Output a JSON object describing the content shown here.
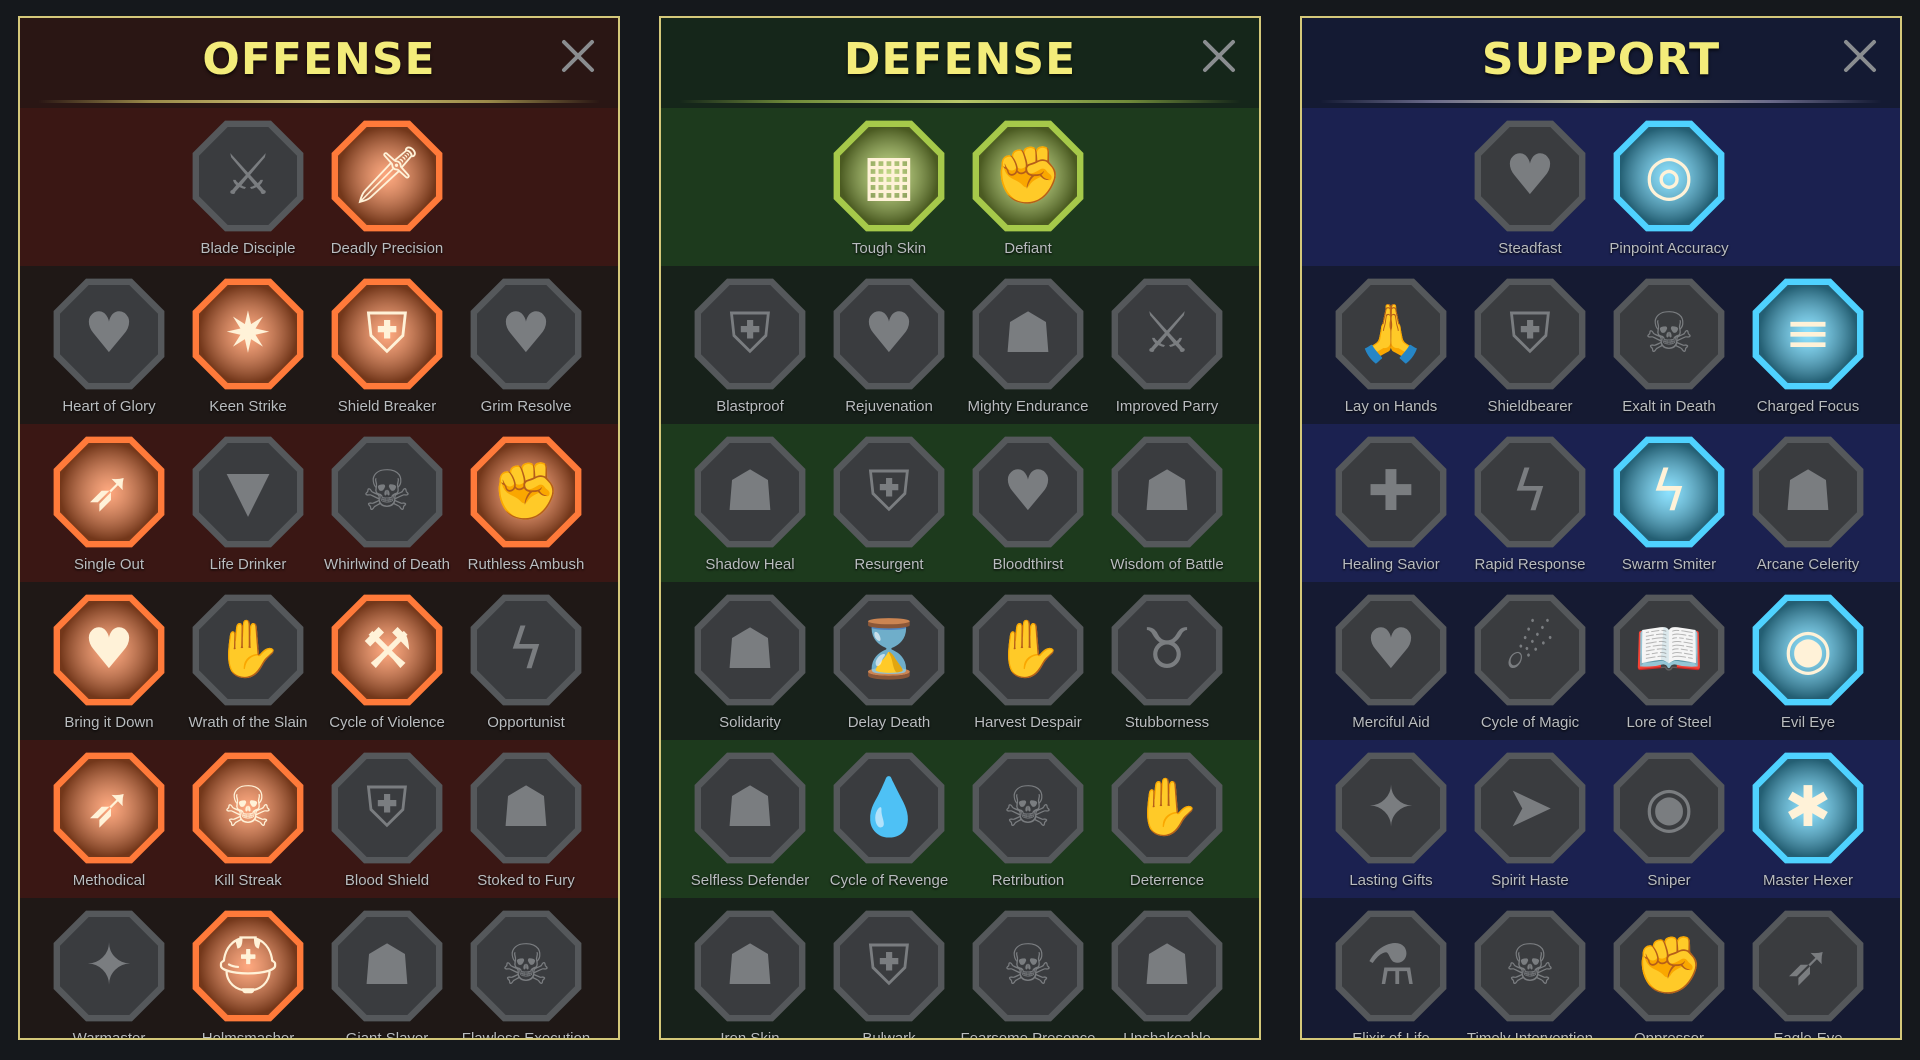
{
  "colors": {
    "title": "#f3ec7a",
    "border": "#d4c87a",
    "offense_active": "#ff7a3a",
    "defense_active": "#a6c94a",
    "support_active": "#4fd2ff",
    "inactive": "#3a3c3f"
  },
  "panels": [
    {
      "id": "offense",
      "title": "OFFENSE",
      "close_icon": "close-x-icon",
      "rows": [
        [
          {
            "label": "Blade Disciple",
            "icon": "crossed-swords-icon",
            "active": false
          },
          {
            "label": "Deadly Precision",
            "icon": "dagger-slash-icon",
            "active": true
          }
        ],
        [
          {
            "label": "Heart of Glory",
            "icon": "horned-heart-figure-icon",
            "active": false
          },
          {
            "label": "Keen Strike",
            "icon": "sword-burst-icon",
            "active": true
          },
          {
            "label": "Shield Breaker",
            "icon": "broken-shield-icon",
            "active": true
          },
          {
            "label": "Grim Resolve",
            "icon": "spiked-heart-icon",
            "active": false
          }
        ],
        [
          {
            "label": "Single Out",
            "icon": "arrows-target-figure-icon",
            "active": true
          },
          {
            "label": "Life Drinker",
            "icon": "fangs-icon",
            "active": false
          },
          {
            "label": "Whirlwind of Death",
            "icon": "skull-whirl-icon",
            "active": false
          },
          {
            "label": "Ruthless Ambush",
            "icon": "fist-blade-icon",
            "active": true
          }
        ],
        [
          {
            "label": "Bring it Down",
            "icon": "dripping-heart-sword-icon",
            "active": true
          },
          {
            "label": "Wrath of the Slain",
            "icon": "grasping-hand-icon",
            "active": false
          },
          {
            "label": "Cycle of Violence",
            "icon": "axe-cycle-icon",
            "active": true
          },
          {
            "label": "Opportunist",
            "icon": "chains-lightning-icon",
            "active": false
          }
        ],
        [
          {
            "label": "Methodical",
            "icon": "arrows-target-icon",
            "active": true
          },
          {
            "label": "Kill Streak",
            "icon": "skull-pile-icon",
            "active": true
          },
          {
            "label": "Blood Shield",
            "icon": "sword-shield-icon",
            "active": false
          },
          {
            "label": "Stoked to Fury",
            "icon": "raging-figure-icon",
            "active": false
          }
        ],
        [
          {
            "label": "Warmaster",
            "icon": "sword-sparkle-icon",
            "active": false
          },
          {
            "label": "Helmsmasher",
            "icon": "cracked-helm-icon",
            "active": true
          },
          {
            "label": "Giant Slayer",
            "icon": "giant-icon",
            "active": false
          },
          {
            "label": "Flawless Execution",
            "icon": "skull-spikes-icon",
            "active": false
          }
        ]
      ]
    },
    {
      "id": "defense",
      "title": "DEFENSE",
      "close_icon": "close-x-icon",
      "rows": [
        [
          {
            "label": "Tough Skin",
            "icon": "armor-plates-icon",
            "active": true
          },
          {
            "label": "Defiant",
            "icon": "raised-fist-icon",
            "active": true
          }
        ],
        [
          {
            "label": "Blastproof",
            "icon": "shield-layers-icon",
            "active": false
          },
          {
            "label": "Rejuvenation",
            "icon": "anatomical-heart-icon",
            "active": false
          },
          {
            "label": "Mighty Endurance",
            "icon": "armored-knight-icon",
            "active": false
          },
          {
            "label": "Improved Parry",
            "icon": "crossed-blades-icon",
            "active": false
          }
        ],
        [
          {
            "label": "Shadow Heal",
            "icon": "shadow-figure-icon",
            "active": false
          },
          {
            "label": "Resurgent",
            "icon": "knight-shield-icon",
            "active": false
          },
          {
            "label": "Bloodthirst",
            "icon": "heart-skull-icon",
            "active": false
          },
          {
            "label": "Wisdom of Battle",
            "icon": "hooded-sage-icon",
            "active": false
          }
        ],
        [
          {
            "label": "Solidarity",
            "icon": "group-figures-icon",
            "active": false
          },
          {
            "label": "Delay Death",
            "icon": "hourglass-icon",
            "active": false
          },
          {
            "label": "Harvest Despair",
            "icon": "open-hand-icon",
            "active": false
          },
          {
            "label": "Stubborness",
            "icon": "bull-head-icon",
            "active": false
          }
        ],
        [
          {
            "label": "Selfless Defender",
            "icon": "running-defender-icon",
            "active": false
          },
          {
            "label": "Cycle of Revenge",
            "icon": "blood-drops-icon",
            "active": false
          },
          {
            "label": "Retribution",
            "icon": "skull-sunburst-icon",
            "active": false
          },
          {
            "label": "Deterrence",
            "icon": "hand-swipe-icon",
            "active": false
          }
        ],
        [
          {
            "label": "Iron Skin",
            "icon": "spiked-warrior-icon",
            "active": false
          },
          {
            "label": "Bulwark",
            "icon": "winged-shield-icon",
            "active": false
          },
          {
            "label": "Fearsome Presence",
            "icon": "skull-rays-icon",
            "active": false
          },
          {
            "label": "Unshakeable",
            "icon": "flexing-figure-icon",
            "active": false
          }
        ]
      ]
    },
    {
      "id": "support",
      "title": "SUPPORT",
      "close_icon": "close-x-icon",
      "rows": [
        [
          {
            "label": "Steadfast",
            "icon": "heart-plus-icon",
            "active": false
          },
          {
            "label": "Pinpoint Accuracy",
            "icon": "target-bolt-icon",
            "active": true
          }
        ],
        [
          {
            "label": "Lay on Hands",
            "icon": "praying-hands-icon",
            "active": false
          },
          {
            "label": "Shieldbearer",
            "icon": "shield-aura-icon",
            "active": false
          },
          {
            "label": "Exalt in Death",
            "icon": "flaming-skull-icon",
            "active": false
          },
          {
            "label": "Charged Focus",
            "icon": "speed-lines-icon",
            "active": true
          }
        ],
        [
          {
            "label": "Healing Savior",
            "icon": "healing-figure-icon",
            "active": false
          },
          {
            "label": "Rapid Response",
            "icon": "lightning-bolt-icon",
            "active": false
          },
          {
            "label": "Swarm Smiter",
            "icon": "zigzag-lightning-icon",
            "active": true
          },
          {
            "label": "Arcane Celerity",
            "icon": "afterimage-figure-icon",
            "active": false
          }
        ],
        [
          {
            "label": "Merciful Aid",
            "icon": "chained-heart-icon",
            "active": false
          },
          {
            "label": "Cycle of Magic",
            "icon": "magic-comet-icon",
            "active": false
          },
          {
            "label": "Lore of Steel",
            "icon": "open-book-icon",
            "active": false
          },
          {
            "label": "Evil Eye",
            "icon": "angry-eyes-icon",
            "active": true
          }
        ],
        [
          {
            "label": "Lasting Gifts",
            "icon": "compass-star-icon",
            "active": false
          },
          {
            "label": "Spirit Haste",
            "icon": "swift-boot-icon",
            "active": false
          },
          {
            "label": "Sniper",
            "icon": "eye-icon",
            "active": false
          },
          {
            "label": "Master Hexer",
            "icon": "voodoo-doll-icon",
            "active": true
          }
        ],
        [
          {
            "label": "Elixir of Life",
            "icon": "potion-flask-icon",
            "active": false
          },
          {
            "label": "Timely Intervention",
            "icon": "skull-hourglass-icon",
            "active": false
          },
          {
            "label": "Oppressor",
            "icon": "crushing-fist-icon",
            "active": false
          },
          {
            "label": "Eagle-Eye",
            "icon": "eagle-head-icon",
            "active": false
          }
        ]
      ]
    }
  ]
}
